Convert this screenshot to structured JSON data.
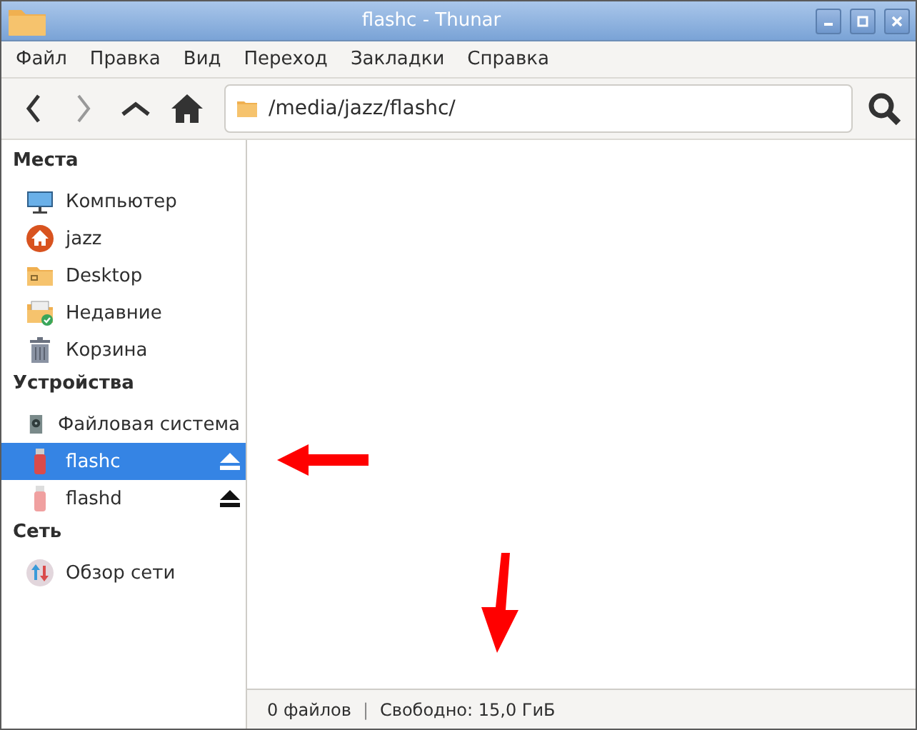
{
  "window": {
    "title": "flashc - Thunar"
  },
  "menu": [
    "Файл",
    "Правка",
    "Вид",
    "Переход",
    "Закладки",
    "Справка"
  ],
  "location": {
    "value": "/media/jazz/flashc/"
  },
  "sidebar": {
    "sections": [
      {
        "title": "Места",
        "items": [
          {
            "label": "Компьютер",
            "kind": "computer",
            "selected": false,
            "ejectable": false
          },
          {
            "label": "jazz",
            "kind": "home",
            "selected": false,
            "ejectable": false
          },
          {
            "label": "Desktop",
            "kind": "desktop",
            "selected": false,
            "ejectable": false
          },
          {
            "label": "Недавние",
            "kind": "recent",
            "selected": false,
            "ejectable": false
          },
          {
            "label": "Корзина",
            "kind": "trash",
            "selected": false,
            "ejectable": false
          }
        ]
      },
      {
        "title": "Устройства",
        "items": [
          {
            "label": "Файловая система",
            "kind": "drive",
            "selected": false,
            "ejectable": false
          },
          {
            "label": "flashc",
            "kind": "usb",
            "selected": true,
            "ejectable": true
          },
          {
            "label": "flashd",
            "kind": "usb-pale",
            "selected": false,
            "ejectable": true
          }
        ]
      },
      {
        "title": "Сеть",
        "items": [
          {
            "label": "Обзор сети",
            "kind": "network",
            "selected": false,
            "ejectable": false
          }
        ]
      }
    ]
  },
  "status_bar": {
    "files": "0 файлов",
    "separator": "|",
    "free": "Свободно: 15,0 ГиБ"
  }
}
